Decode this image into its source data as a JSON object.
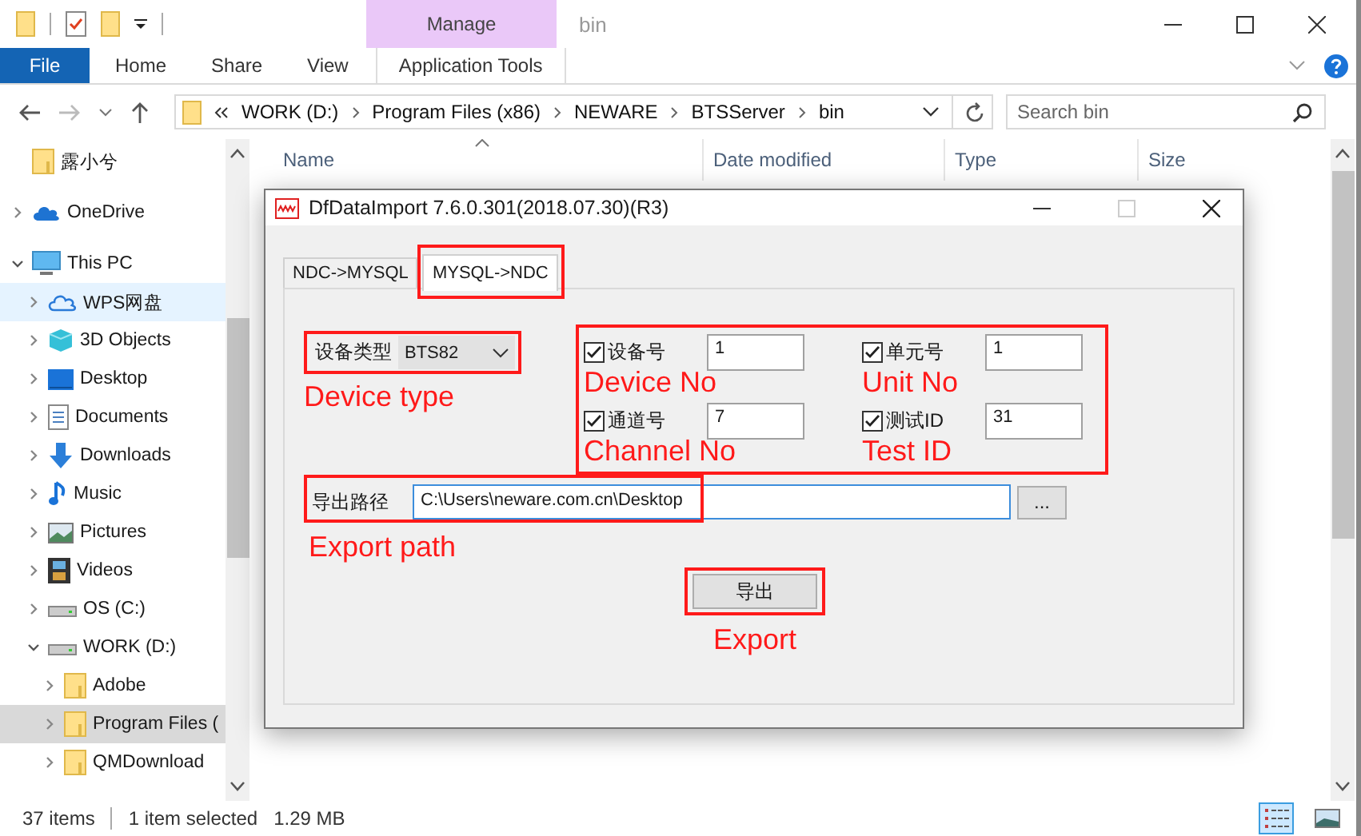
{
  "window": {
    "title": "bin",
    "context_group": "Manage"
  },
  "ribbon_tabs": [
    {
      "label": "File",
      "kind": "file"
    },
    {
      "label": "Home",
      "kind": "tab"
    },
    {
      "label": "Share",
      "kind": "tab"
    },
    {
      "label": "View",
      "kind": "tab"
    },
    {
      "label": "Application Tools",
      "kind": "context"
    }
  ],
  "address": {
    "path": [
      "WORK (D:)",
      "Program Files (x86)",
      "NEWARE",
      "BTSServer",
      "bin"
    ]
  },
  "search": {
    "placeholder": "Search bin"
  },
  "nav_tree": [
    {
      "label": "露小兮",
      "kind": "folder",
      "selected": false,
      "hovered": false
    },
    {
      "label": "OneDrive",
      "kind": "onedrive",
      "expanded": false,
      "selected": false,
      "hovered": false
    },
    {
      "label": "This PC",
      "kind": "pc",
      "expanded": true,
      "selected": false,
      "hovered": false,
      "children": [
        {
          "label": "WPS网盘",
          "kind": "cloud",
          "expanded": false,
          "selected": false,
          "hovered": true
        },
        {
          "label": "3D Objects",
          "kind": "cube",
          "expanded": false,
          "selected": false,
          "hovered": false
        },
        {
          "label": "Desktop",
          "kind": "desktop",
          "expanded": false,
          "selected": false,
          "hovered": false
        },
        {
          "label": "Documents",
          "kind": "document",
          "expanded": false,
          "selected": false,
          "hovered": false
        },
        {
          "label": "Downloads",
          "kind": "download",
          "expanded": false,
          "selected": false,
          "hovered": false
        },
        {
          "label": "Music",
          "kind": "music",
          "expanded": false,
          "selected": false,
          "hovered": false
        },
        {
          "label": "Pictures",
          "kind": "pictures",
          "expanded": false,
          "selected": false,
          "hovered": false
        },
        {
          "label": "Videos",
          "kind": "videos",
          "expanded": false,
          "selected": false,
          "hovered": false
        },
        {
          "label": "OS (C:)",
          "kind": "drive",
          "expanded": false,
          "selected": false,
          "hovered": false
        },
        {
          "label": "WORK (D:)",
          "kind": "drive",
          "expanded": true,
          "selected": false,
          "hovered": false,
          "children": [
            {
              "label": "Adobe",
              "kind": "folder",
              "expanded": false,
              "selected": false,
              "hovered": false
            },
            {
              "label": "Program Files (",
              "kind": "folder",
              "expanded": false,
              "selected": true,
              "hovered": false
            },
            {
              "label": "QMDownload",
              "kind": "folder",
              "expanded": false,
              "selected": false,
              "hovered": false
            }
          ]
        }
      ]
    }
  ],
  "file_list": {
    "columns": [
      {
        "label": "Name",
        "sorted": true
      },
      {
        "label": "Date modified",
        "sorted": false
      },
      {
        "label": "Type",
        "sorted": false
      },
      {
        "label": "Size",
        "sorted": false
      }
    ]
  },
  "status_bar": {
    "item_count": "37 items",
    "selection": "1 item selected",
    "selection_size": "1.29 MB"
  },
  "view_modes": [
    {
      "kind": "details",
      "selected": true
    },
    {
      "kind": "thumbnails",
      "selected": false
    }
  ],
  "dialog": {
    "title": "DfDataImport 7.6.0.301(2018.07.30)(R3)",
    "tabs": [
      {
        "label": "NDC->MYSQL",
        "selected": false,
        "highlighted": false
      },
      {
        "label": "MYSQL->NDC",
        "selected": true,
        "highlighted": true
      }
    ],
    "device_type": {
      "label": "设备类型",
      "value": "BTS82",
      "annotation": "Device type"
    },
    "id_fields": [
      {
        "label": "设备号",
        "checked": true,
        "value": "1",
        "annotation": "Device No"
      },
      {
        "label": "单元号",
        "checked": true,
        "value": "1",
        "annotation": "Unit No"
      },
      {
        "label": "通道号",
        "checked": true,
        "value": "7",
        "annotation": "Channel No"
      },
      {
        "label": "测试ID",
        "checked": true,
        "value": "31",
        "annotation": "Test ID"
      }
    ],
    "export_path": {
      "label": "导出路径",
      "value": "C:\\Users\\neware.com.cn\\Desktop",
      "browse_label": "...",
      "annotation": "Export path"
    },
    "export_button": {
      "label": "导出",
      "annotation": "Export"
    }
  }
}
